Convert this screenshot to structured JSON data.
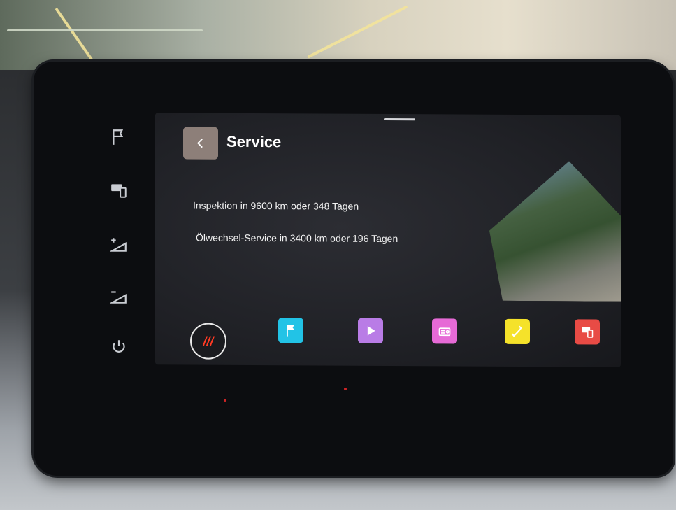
{
  "header": {
    "title": "Service"
  },
  "messages": [
    "Inspektion in 9600 km oder 348 Tagen",
    "Ölwechsel-Service in 3400 km oder 196 Tagen"
  ],
  "sidebar": {
    "items": [
      {
        "icon": "flag-icon"
      },
      {
        "icon": "keyboard-phone-icon"
      },
      {
        "icon": "volume-up-icon"
      },
      {
        "icon": "volume-down-icon"
      },
      {
        "icon": "power-icon"
      }
    ]
  },
  "dock": {
    "home_label": "///",
    "items": [
      {
        "icon": "navigation-flag-icon",
        "color": "#22c3e6"
      },
      {
        "icon": "media-play-icon",
        "color": "#b97ce6"
      },
      {
        "icon": "radio-icon",
        "color": "#e66ad6"
      },
      {
        "icon": "phone-icon",
        "color": "#f5e22a"
      },
      {
        "icon": "car-settings-icon",
        "color": "#e84b45"
      }
    ]
  },
  "colors": {
    "accent": "#ff3b24",
    "back_button": "#8d7f79"
  }
}
